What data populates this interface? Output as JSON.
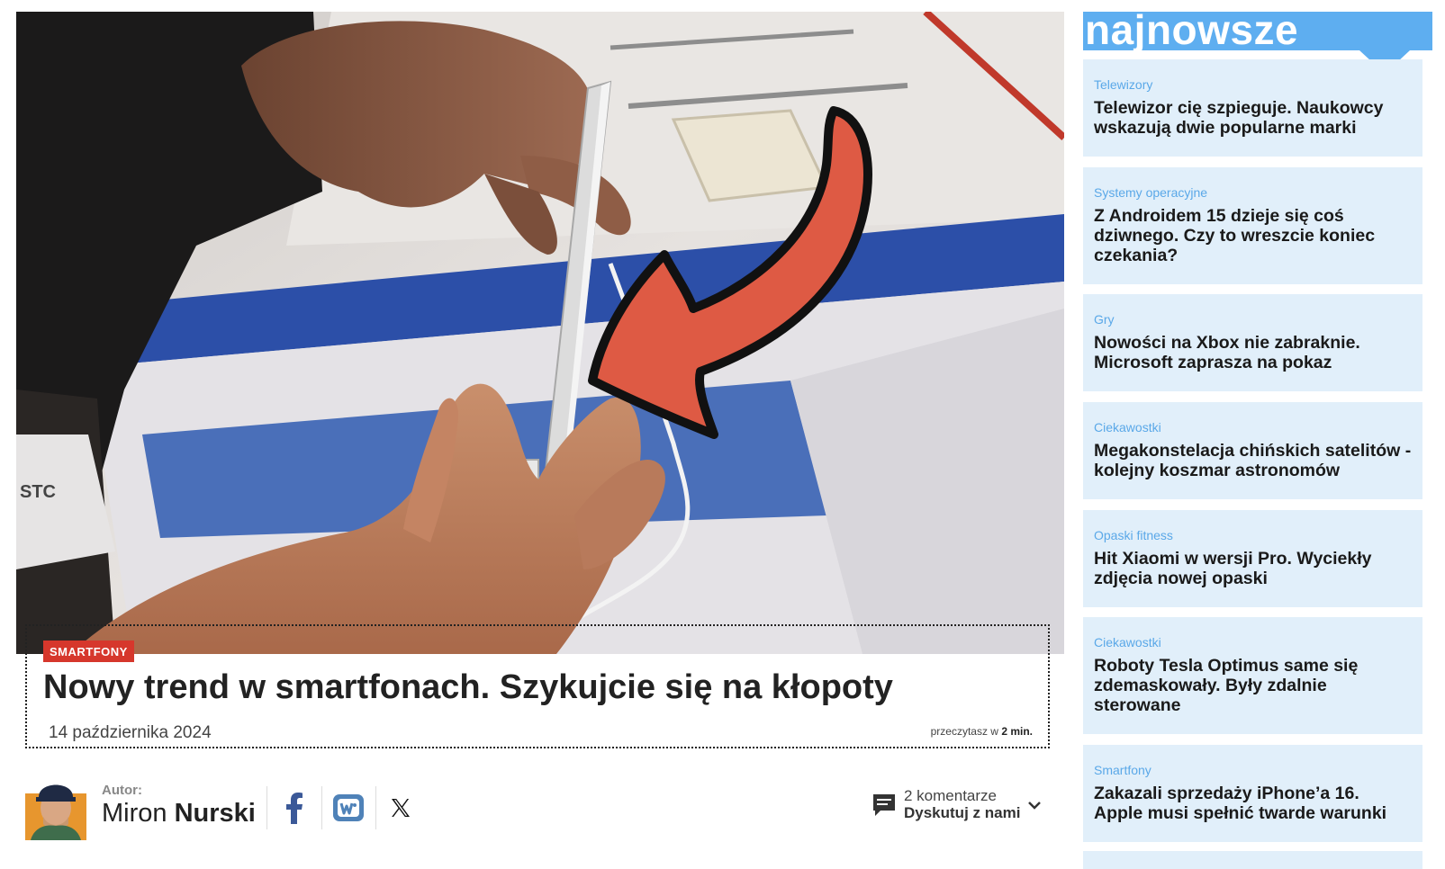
{
  "article": {
    "category": "SMARTFONY",
    "title": "Nowy trend w smartfonach. Szykujcie się na kłopoty",
    "date": "14 października 2024",
    "reading_prefix": "przeczytasz w",
    "reading_time": "2 min.",
    "author_label": "Autor:",
    "author_first": "Miron",
    "author_last": "Nurski",
    "comments_count": "2 komentarze",
    "comments_cta": "Dyskutuj z nami"
  },
  "hero_image": {
    "description_icon": "arrow-icon",
    "colors": {
      "arrow": "#de5a44",
      "table_blue": "#2c4fa8"
    }
  },
  "social": [
    "facebook-icon",
    "wykop-icon",
    "x-icon"
  ],
  "sidebar": {
    "title": "najnowsze",
    "accent": "#5eaef0",
    "items": [
      {
        "category": "Telewizory",
        "title": "Telewizor cię szpieguje. Naukowcy wskazują dwie popularne marki"
      },
      {
        "category": "Systemy operacyjne",
        "title": "Z Androidem 15 dzieje się coś dziwnego. Czy to wreszcie koniec czekania?"
      },
      {
        "category": "Gry",
        "title": "Nowości na Xbox nie zabraknie. Microsoft zaprasza na pokaz"
      },
      {
        "category": "Ciekawostki",
        "title": "Megakonstelacja chińskich satelitów - kolejny koszmar astronomów"
      },
      {
        "category": "Opaski fitness",
        "title": "Hit Xiaomi w wersji Pro. Wyciekły zdjęcia nowej opaski"
      },
      {
        "category": "Ciekawostki",
        "title": "Roboty Tesla Optimus same się zdemaskowały. Były zdalnie sterowane"
      },
      {
        "category": "Smartfony",
        "title": "Zakazali sprzedaży iPhone’a 16. Apple musi spełnić twarde warunki"
      }
    ]
  }
}
